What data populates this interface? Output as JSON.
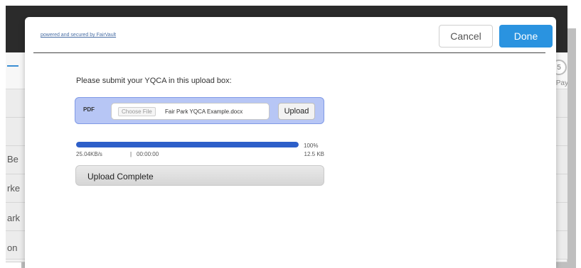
{
  "background": {
    "rows": [
      "Be",
      "rke",
      "ark",
      "on"
    ],
    "step": {
      "number": "5",
      "label": "Pay"
    }
  },
  "modal": {
    "powered_text": "powered and secured by FairVault",
    "cancel_label": "Cancel",
    "done_label": "Done",
    "instruction": "Please submit your YQCA in this upload box:",
    "upload": {
      "type_label": "PDF",
      "choose_file_label": "Choose File",
      "file_name": "Fair Park YQCA Example.docx",
      "upload_label": "Upload"
    },
    "progress": {
      "percent": 100,
      "percent_label": "100%",
      "speed": "25.04KB/s",
      "divider": "|",
      "elapsed": "00:00:00",
      "size": "12.5 KB"
    },
    "status": "Upload Complete"
  },
  "colors": {
    "done_button": "#2a93e0",
    "upload_box": "#b7c6f5",
    "progress_fill": "#2d5fc9"
  }
}
